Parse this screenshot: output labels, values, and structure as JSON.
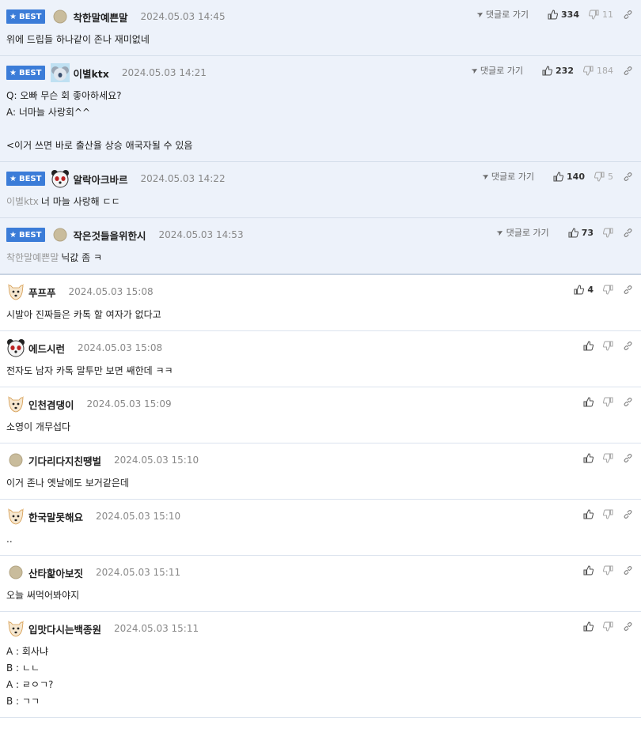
{
  "ui": {
    "best_label": "BEST",
    "goto_label": "댓글로 가기"
  },
  "best_comments": [
    {
      "nick": "착한말예쁜말",
      "date": "2024.05.03 14:45",
      "up": "334",
      "down": "11",
      "reply_to": "",
      "lines": [
        "위에 드립들 하나같이 존나 재미없네"
      ],
      "avatar": "dot-avatar-icon"
    },
    {
      "nick": "이별ktx",
      "date": "2024.05.03 14:21",
      "up": "232",
      "down": "184",
      "reply_to": "",
      "lines": [
        "Q: 오빠 무슨 회 좋아하세요?",
        "A: 너마늘 사랑회^^",
        "",
        "<이거 쓰면 바로 출산율 상승 애국자될 수 있음"
      ],
      "avatar": "koala-avatar-icon"
    },
    {
      "nick": "알락아크바르",
      "date": "2024.05.03 14:22",
      "up": "140",
      "down": "5",
      "reply_to": "이별ktx",
      "lines": [
        "너 마늘 사랑해 ㄷㄷ"
      ],
      "avatar": "panda-avatar-icon"
    },
    {
      "nick": "작은것들을위한시",
      "date": "2024.05.03 14:53",
      "up": "73",
      "down": "",
      "reply_to": "착한말예쁜말",
      "lines": [
        "닉값 좀 ㅋ"
      ],
      "avatar": "dot-avatar-icon"
    }
  ],
  "comments": [
    {
      "nick": "푸프푸",
      "date": "2024.05.03 15:08",
      "up": "4",
      "lines": [
        "시발아 진짜들은 카톡 할 여자가 없다고"
      ],
      "avatar": "dog-avatar-icon"
    },
    {
      "nick": "에드시런",
      "date": "2024.05.03 15:08",
      "up": "",
      "lines": [
        "전자도 남자 카톡 말투만 보면 쌔한데 ㅋㅋ"
      ],
      "avatar": "panda-avatar-icon"
    },
    {
      "nick": "인천겸댕이",
      "date": "2024.05.03 15:09",
      "up": "",
      "lines": [
        "소영이 개무섭다"
      ],
      "avatar": "dog-avatar-icon"
    },
    {
      "nick": "기다리다지친땡벌",
      "date": "2024.05.03 15:10",
      "up": "",
      "lines": [
        "이거 존나 옛날에도 보거같은데"
      ],
      "avatar": "dot-avatar-icon"
    },
    {
      "nick": "한국말못해요",
      "date": "2024.05.03 15:10",
      "up": "",
      "lines": [
        ".."
      ],
      "avatar": "dog-avatar-icon"
    },
    {
      "nick": "산타핥아보짓",
      "date": "2024.05.03 15:11",
      "up": "",
      "lines": [
        "오늘 써먹어봐야지"
      ],
      "avatar": "dot-avatar-icon"
    },
    {
      "nick": "입맛다시는백종원",
      "date": "2024.05.03 15:11",
      "up": "",
      "lines": [
        "A : 회사냐",
        "B : ㄴㄴ",
        "A : ㄹㅇㄱ?",
        "B : ㄱㄱ"
      ],
      "avatar": "dog-avatar-icon"
    }
  ]
}
